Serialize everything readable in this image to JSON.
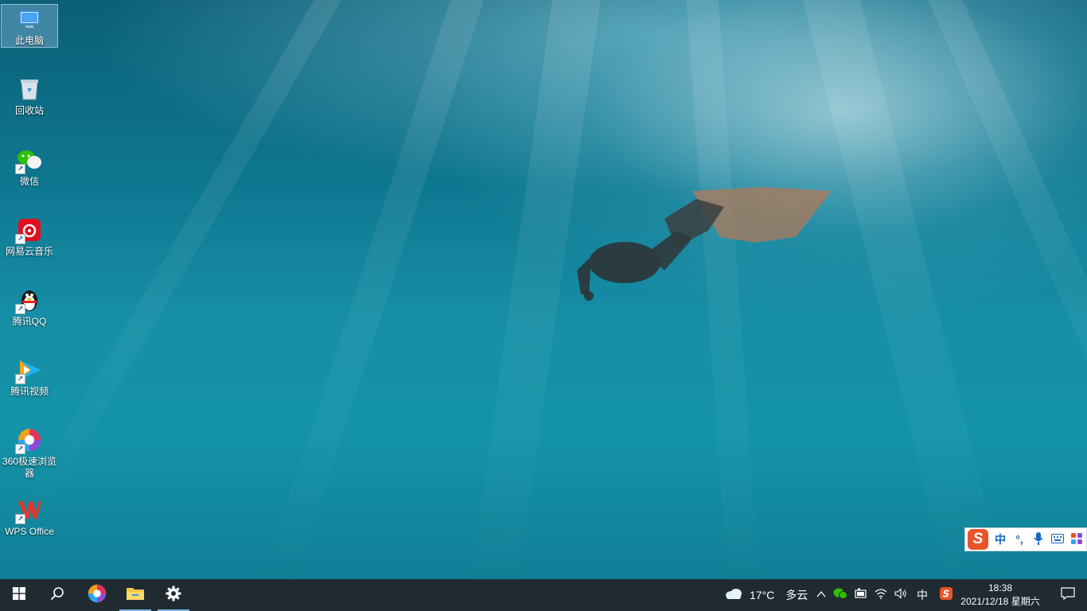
{
  "desktop": {
    "icons": [
      {
        "label": "此电脑",
        "icon": "computer-icon"
      },
      {
        "label": "回收站",
        "icon": "recycle-bin-icon"
      },
      {
        "label": "微信",
        "icon": "wechat-icon"
      },
      {
        "label": "网易云音乐",
        "icon": "netease-music-icon"
      },
      {
        "label": "腾讯QQ",
        "icon": "qq-penguin-icon"
      },
      {
        "label": "腾讯视频",
        "icon": "tencent-video-icon"
      },
      {
        "label": "360极速浏览器",
        "icon": "360-browser-icon"
      },
      {
        "label": "WPS Office",
        "icon": "wps-office-icon"
      }
    ]
  },
  "ime": {
    "logo": "S",
    "mode": "中",
    "punct": "°,",
    "mic_icon": "microphone-icon",
    "keyboard_icon": "keyboard-icon",
    "apps_icon": "grid-icon"
  },
  "taskbar": {
    "start_icon": "windows-logo-icon",
    "search_icon": "search-icon",
    "apps": [
      {
        "icon": "360-browser-icon"
      },
      {
        "icon": "file-explorer-icon"
      },
      {
        "icon": "gear-icon"
      }
    ],
    "weather": {
      "icon": "cloud-icon",
      "temp": "17°C",
      "desc": "多云"
    },
    "tray": {
      "chevron_icon": "chevron-up-icon",
      "input_lang": "中",
      "ime_icon": "sogou-icon"
    },
    "clock": {
      "time": "18:38",
      "date": "2021/12/18 星期六"
    },
    "notification_icon": "notification-icon"
  },
  "colors": {
    "taskbar_bg": "#1f2b31",
    "ime_accent": "#e8542a",
    "ime_blue": "#1565c0",
    "running_indicator": "#78b4e6"
  }
}
